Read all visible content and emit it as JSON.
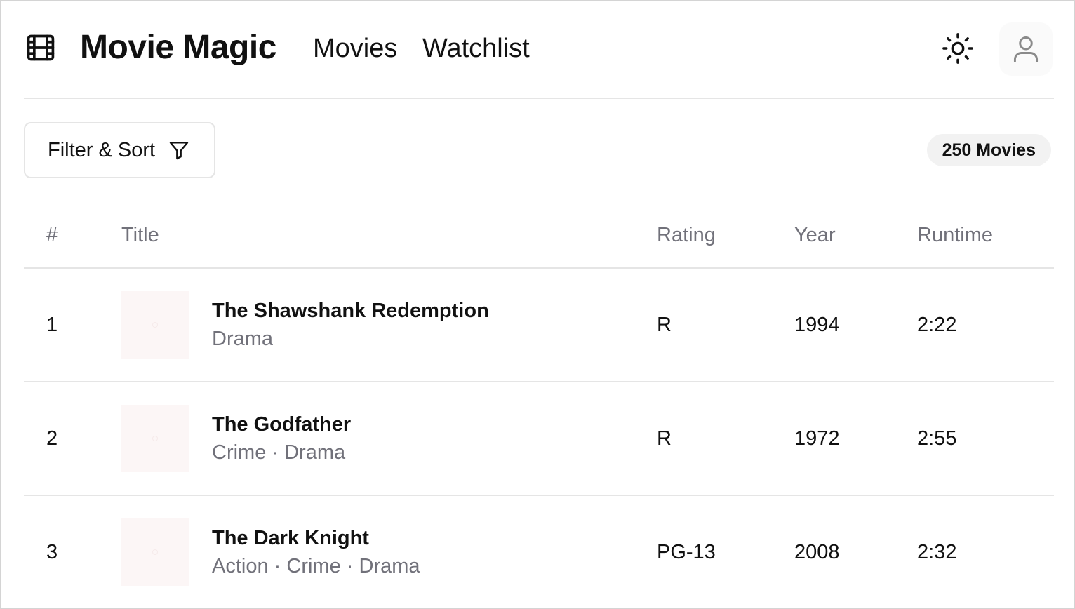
{
  "header": {
    "logo_icon": "film-icon",
    "brand": "Movie Magic",
    "nav": {
      "movies": "Movies",
      "watchlist": "Watchlist"
    },
    "theme_icon": "sun-icon",
    "user_icon": "user-icon"
  },
  "toolbar": {
    "filter_label": "Filter & Sort",
    "filter_icon": "funnel-icon",
    "count": "250 Movies"
  },
  "table": {
    "headers": {
      "num": "#",
      "title": "Title",
      "rating": "Rating",
      "year": "Year",
      "runtime": "Runtime"
    },
    "rows": [
      {
        "num": "1",
        "title": "The Shawshank Redemption",
        "genres": "Drama",
        "rating": "R",
        "year": "1994",
        "runtime": "2:22"
      },
      {
        "num": "2",
        "title": "The Godfather",
        "genres": "Crime · Drama",
        "rating": "R",
        "year": "1972",
        "runtime": "2:55"
      },
      {
        "num": "3",
        "title": "The Dark Knight",
        "genres": "Action · Crime · Drama",
        "rating": "PG-13",
        "year": "2008",
        "runtime": "2:32"
      }
    ]
  },
  "colors": {
    "muted_text": "#71717a",
    "border": "#e5e5e5",
    "poster_placeholder": "#fcf6f6",
    "badge_bg": "#f2f2f2"
  }
}
